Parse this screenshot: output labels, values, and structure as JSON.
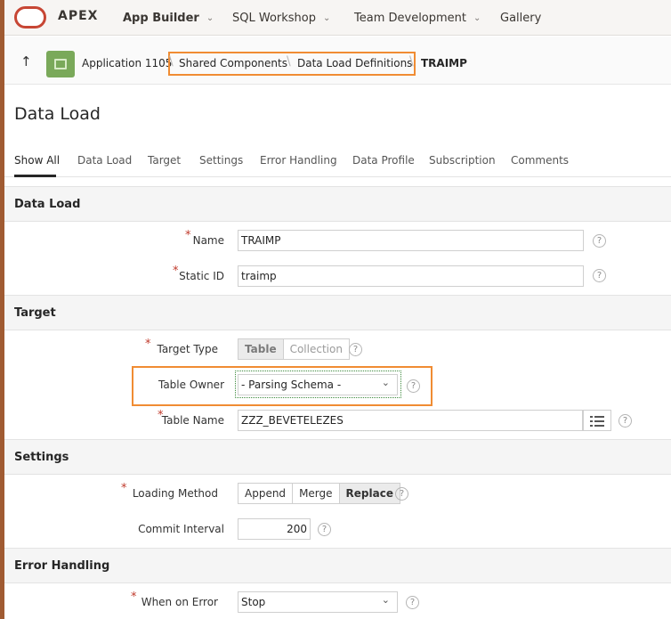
{
  "topbar": {
    "brand": "APEX",
    "nav": [
      {
        "label": "App Builder",
        "has_menu": true
      },
      {
        "label": "SQL Workshop",
        "has_menu": true
      },
      {
        "label": "Team Development",
        "has_menu": true
      },
      {
        "label": "Gallery",
        "has_menu": false
      }
    ]
  },
  "breadcrumb": {
    "app": "Application 1105",
    "items": [
      "Shared Components",
      "Data Load Definitions"
    ],
    "current": "TRAIMP"
  },
  "page": {
    "title": "Data Load"
  },
  "tabs": [
    "Show All",
    "Data Load",
    "Target",
    "Settings",
    "Error Handling",
    "Data Profile",
    "Subscription",
    "Comments"
  ],
  "regions": {
    "data_load": {
      "title": "Data Load",
      "name_label": "Name",
      "name_value": "TRAIMP",
      "static_id_label": "Static ID",
      "static_id_value": "traimp"
    },
    "target": {
      "title": "Target",
      "target_type_label": "Target Type",
      "target_type_options": [
        "Table",
        "Collection"
      ],
      "table_owner_label": "Table Owner",
      "table_owner_value": "- Parsing Schema -",
      "table_name_label": "Table Name",
      "table_name_value": "ZZZ_BEVETELEZES"
    },
    "settings": {
      "title": "Settings",
      "loading_method_label": "Loading Method",
      "loading_method_options": [
        "Append",
        "Merge",
        "Replace"
      ],
      "commit_interval_label": "Commit Interval",
      "commit_interval_value": "200"
    },
    "error_handling": {
      "title": "Error Handling",
      "when_on_error_label": "When on Error",
      "when_on_error_value": "Stop"
    }
  },
  "help_glyph": "?",
  "required_glyph": "*",
  "colors": {
    "highlight": "#f08c33",
    "app_icon": "#7aa95a",
    "oracle_red": "#c74634",
    "required": "#c0392b"
  }
}
